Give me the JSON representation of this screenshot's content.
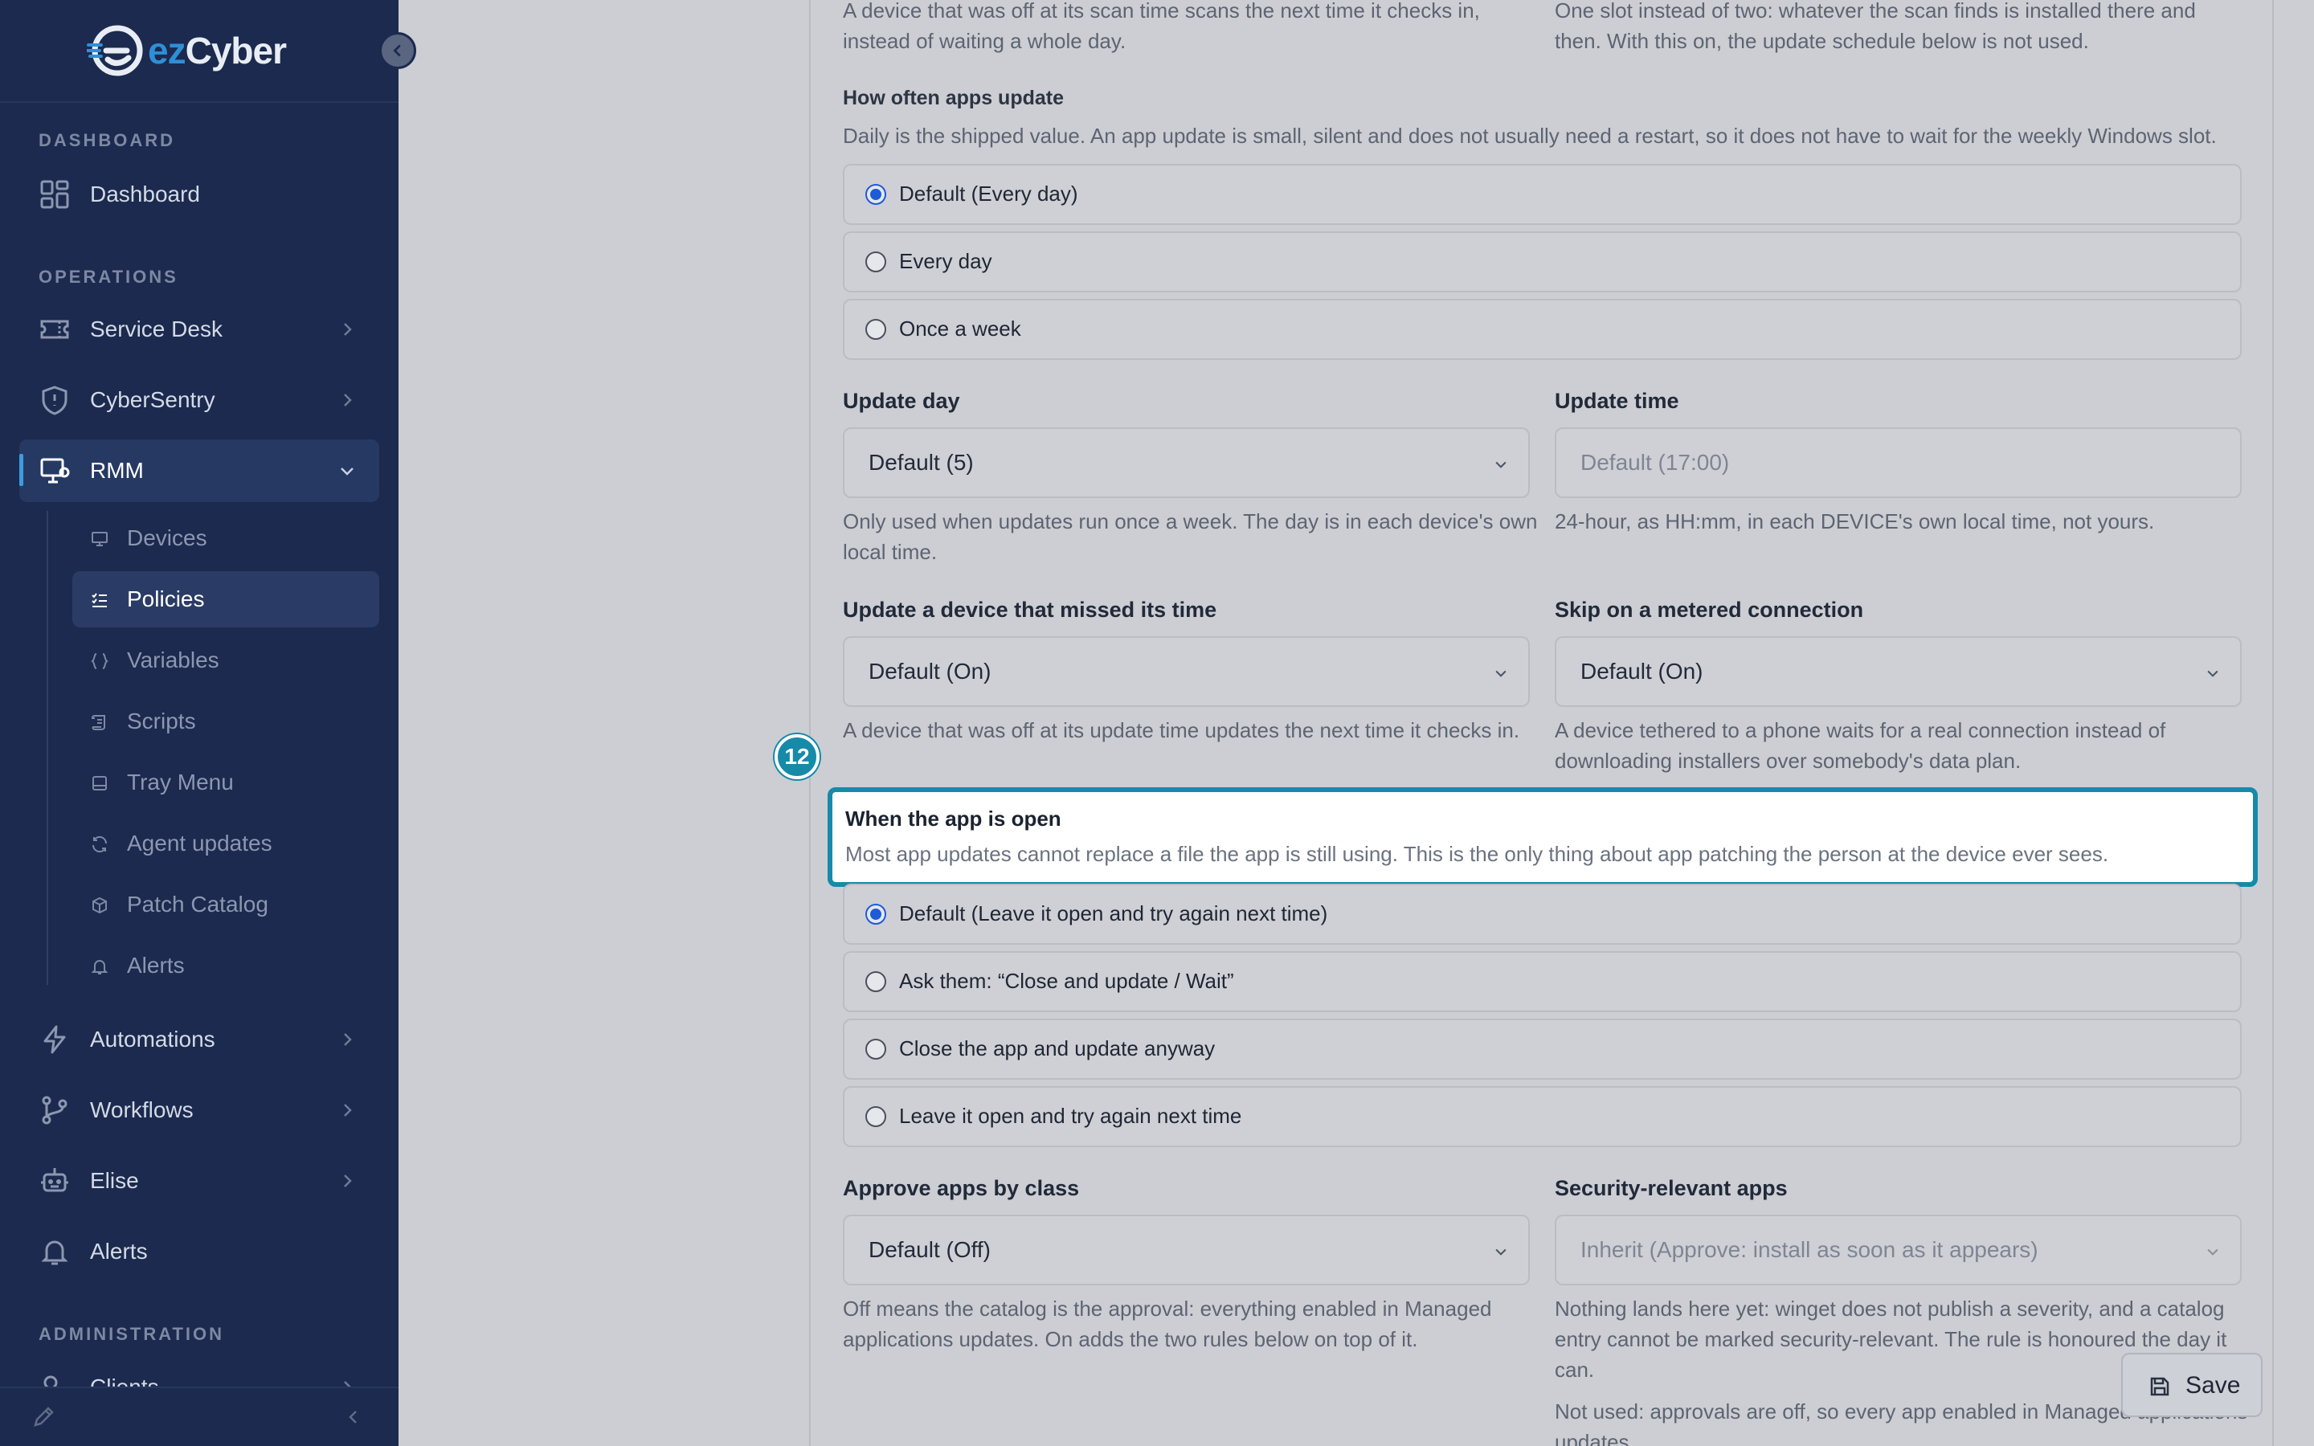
{
  "brand": {
    "ez": "ez",
    "name": "Cyber"
  },
  "sidebar": {
    "sections": {
      "dashboard": "DASHBOARD",
      "operations": "OPERATIONS",
      "administration": "ADMINISTRATION"
    },
    "items": {
      "dashboard": "Dashboard",
      "service_desk": "Service Desk",
      "cybersentry": "CyberSentry",
      "rmm": "RMM",
      "automations": "Automations",
      "workflows": "Workflows",
      "elise": "Elise",
      "alerts": "Alerts",
      "clients": "Clients"
    },
    "rmm_sub": {
      "devices": "Devices",
      "policies": "Policies",
      "variables": "Variables",
      "scripts": "Scripts",
      "tray_menu": "Tray Menu",
      "agent_updates": "Agent updates",
      "patch_catalog": "Patch Catalog",
      "alerts": "Alerts"
    }
  },
  "form": {
    "top_left_desc": "A device that was off at its scan time scans the next time it checks in, instead of waiting a whole day.",
    "top_right_desc": "One slot instead of two: whatever the scan finds is installed there and then. With this on, the update schedule below is not used.",
    "how_often": {
      "label": "How often apps update",
      "desc": "Daily is the shipped value. An app update is small, silent and does not usually need a restart, so it does not have to wait for the weekly Windows slot.",
      "options": [
        "Default (Every day)",
        "Every day",
        "Once a week"
      ],
      "selected": 0
    },
    "update_day": {
      "label": "Update day",
      "value": "Default (5)",
      "help": "Only used when updates run once a week. The day is in each device's own local time."
    },
    "update_time": {
      "label": "Update time",
      "placeholder": "Default (17:00)",
      "help": "24-hour, as HH:mm, in each DEVICE's own local time, not yours."
    },
    "missed": {
      "label": "Update a device that missed its time",
      "value": "Default (On)",
      "help": "A device that was off at its update time updates the next time it checks in."
    },
    "metered": {
      "label": "Skip on a metered connection",
      "value": "Default (On)",
      "help": "A device tethered to a phone waits for a real connection instead of downloading installers over somebody's data plan."
    },
    "app_open": {
      "label": "When the app is open",
      "desc": "Most app updates cannot replace a file the app is still using. This is the only thing about app patching the person at the device ever sees.",
      "options": [
        "Default (Leave it open and try again next time)",
        "Ask them: “Close and update / Wait”",
        "Close the app and update anyway",
        "Leave it open and try again next time"
      ],
      "selected": 0
    },
    "approve_class": {
      "label": "Approve apps by class",
      "value": "Default (Off)",
      "help": "Off means the catalog is the approval: everything enabled in Managed applications updates. On adds the two rules below on top of it."
    },
    "security_apps": {
      "label": "Security-relevant apps",
      "value": "Inherit (Approve: install as soon as it appears)",
      "help1": "Nothing lands here yet: winget does not publish a severity, and a catalog entry cannot be marked security-relevant. The rule is honoured the day it can.",
      "help2": "Not used: approvals are off, so every app enabled in Managed applications updates."
    }
  },
  "tour": {
    "step": "12"
  },
  "actions": {
    "save": "Save"
  },
  "colors": {
    "sidebar_bg": "#1b2a4e",
    "accent": "#178aa8",
    "radio": "#1e5bd6"
  }
}
